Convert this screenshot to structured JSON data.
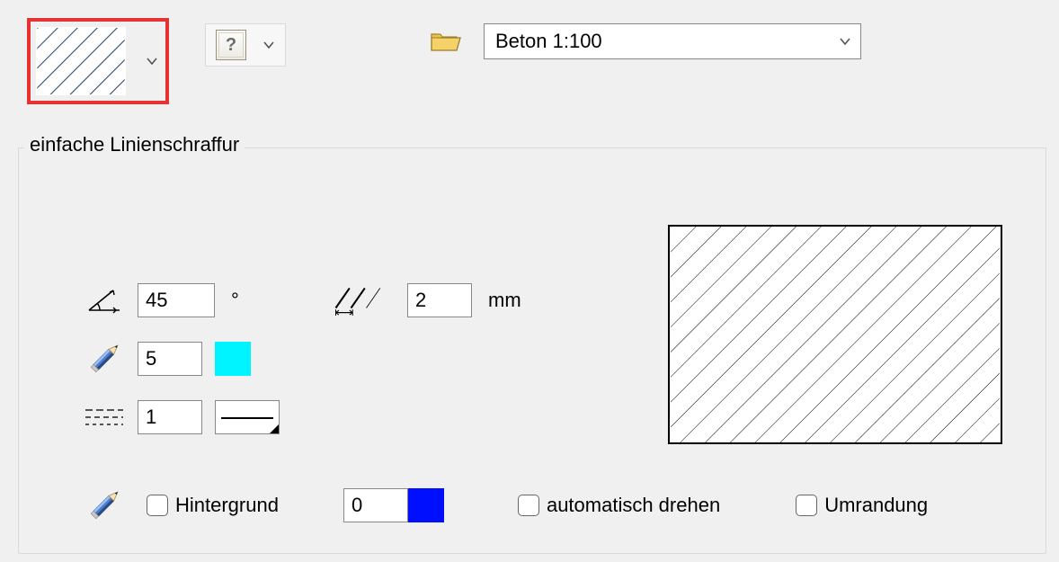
{
  "toolbar": {
    "preset_selected": "Beton 1:100"
  },
  "group": {
    "title": "einfache Linienschraffur"
  },
  "params": {
    "angle": "45",
    "angle_unit": "°",
    "spacing": "2",
    "spacing_unit": "mm",
    "pen": "5",
    "linetype": "1",
    "bg_pen": "0"
  },
  "colors": {
    "pen_color": "#00f4ff",
    "bg_color": "#0010ff"
  },
  "checkboxes": {
    "background_label": "Hintergrund",
    "auto_rotate_label": "automatisch drehen",
    "border_label": "Umrandung"
  },
  "icons": {
    "hatch_picker": "hatch-pattern-icon",
    "help": "help-icon",
    "folder": "folder-open-icon",
    "angle": "angle-icon",
    "spacing": "hatch-spacing-icon",
    "pen": "pencil-icon",
    "linetype": "dashed-line-icon"
  }
}
